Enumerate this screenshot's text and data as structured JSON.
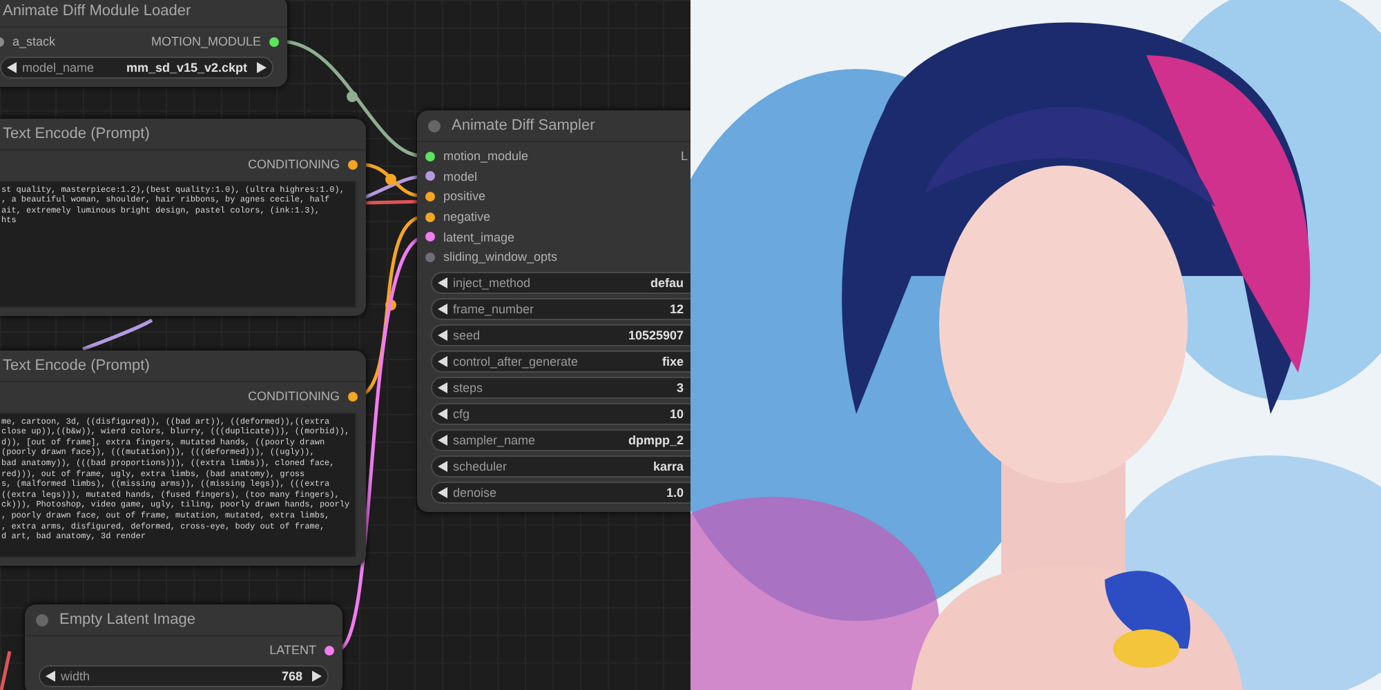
{
  "nodes": [
    {
      "title": "Animate Diff Module Loader",
      "inputs": [
        {
          "label": "a_stack",
          "color": "#8a8a8a"
        }
      ],
      "outputs": [
        {
          "label": "MOTION_MODULE",
          "color": "#5ee35e"
        }
      ],
      "widgets": [
        {
          "label": "model_name",
          "value": "mm_sd_v15_v2.ckpt"
        }
      ]
    },
    {
      "title": "Text Encode (Prompt)",
      "outputs": [
        {
          "label": "CONDITIONING",
          "color": "#f5a524"
        }
      ],
      "text_lines": [
        "st quality, masterpiece:1.2),(best quality:1.0), (ultra highres:1.0),",
        ", a beautiful woman, shoulder, hair ribbons, by agnes cecile, half",
        "ait, extremely luminous bright design, pastel colors, (ink:1.3),",
        "hts"
      ]
    },
    {
      "title": "Text Encode (Prompt)",
      "outputs": [
        {
          "label": "CONDITIONING",
          "color": "#f5a524"
        }
      ],
      "text_lines": [
        "me, cartoon, 3d, ((disfigured)), ((bad art)), ((deformed)),((extra",
        "close up)),((b&w)), wierd colors, blurry, (((duplicate))), ((morbid)),",
        "d)), [out of frame], extra fingers, mutated hands, ((poorly drawn",
        "(poorly drawn face)), (((mutation))), (((deformed))), ((ugly)),",
        "bad anatomy)), (((bad proportions))), ((extra limbs)), cloned face,",
        "red))), out of frame, ugly, extra limbs, (bad anatomy), gross",
        "s, (malformed limbs), ((missing arms)), ((missing legs)), (((extra",
        "((extra legs))), mutated hands, (fused fingers), (too many fingers),",
        "ck))), Photoshop, video game, ugly, tiling, poorly drawn hands, poorly",
        ", poorly drawn face, out of frame, mutation, mutated, extra limbs,",
        ", extra arms, disfigured, deformed, cross-eye, body out of frame,",
        "d art, bad anatomy, 3d render"
      ]
    },
    {
      "title": "Animate Diff Sampler",
      "inputs": [
        {
          "label": "motion_module",
          "color": "#5ee35e"
        },
        {
          "label": "model",
          "color": "#b49be0"
        },
        {
          "label": "positive",
          "color": "#f5a524"
        },
        {
          "label": "negative",
          "color": "#f5a524"
        },
        {
          "label": "latent_image",
          "color": "#f27cf0"
        },
        {
          "label": "sliding_window_opts",
          "color": "#6e6e78"
        }
      ],
      "outputs": [
        {
          "label": "L"
        }
      ],
      "widgets": [
        {
          "label": "inject_method",
          "value": "defau"
        },
        {
          "label": "frame_number",
          "value": "12"
        },
        {
          "label": "seed",
          "value": "10525907"
        },
        {
          "label": "control_after_generate",
          "value": "fixe"
        },
        {
          "label": "steps",
          "value": "3"
        },
        {
          "label": "cfg",
          "value": "10"
        },
        {
          "label": "sampler_name",
          "value": "dpmpp_2"
        },
        {
          "label": "scheduler",
          "value": "karra"
        },
        {
          "label": "denoise",
          "value": "1.0"
        }
      ]
    },
    {
      "title": "Empty Latent Image",
      "outputs": [
        {
          "label": "LATENT",
          "color": "#f27cf0"
        }
      ],
      "widgets": [
        {
          "label": "width",
          "value": "768"
        }
      ]
    }
  ]
}
